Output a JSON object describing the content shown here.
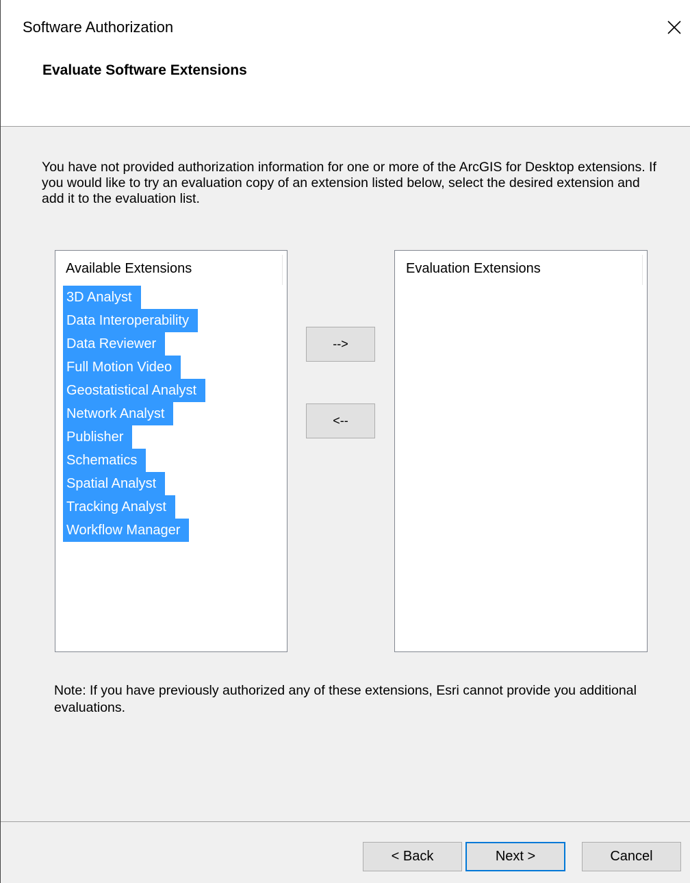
{
  "window": {
    "title": "Software Authorization"
  },
  "page": {
    "heading": "Evaluate Software Extensions",
    "description": "You have not provided authorization information for one or more of the ArcGIS for Desktop extensions.  If you would like to try an evaluation copy of an extension listed below, select the desired extension and add it to the evaluation list.",
    "note": "Note:  If you have previously authorized any of these extensions, Esri cannot provide you additional evaluations."
  },
  "available": {
    "header": "Available Extensions",
    "items": [
      "3D Analyst",
      "Data Interoperability",
      "Data Reviewer",
      "Full Motion Video",
      "Geostatistical Analyst",
      "Network Analyst",
      "Publisher",
      "Schematics",
      "Spatial Analyst",
      "Tracking Analyst",
      "Workflow Manager"
    ]
  },
  "evaluation": {
    "header": "Evaluation Extensions",
    "items": []
  },
  "transfer": {
    "add_label": "-->",
    "remove_label": "<--"
  },
  "buttons": {
    "back": "< Back",
    "next": "Next >",
    "cancel": "Cancel"
  },
  "colors": {
    "selection": "#3399ff",
    "focus_border": "#0078d7"
  },
  "icons": {
    "close": "close-icon"
  }
}
